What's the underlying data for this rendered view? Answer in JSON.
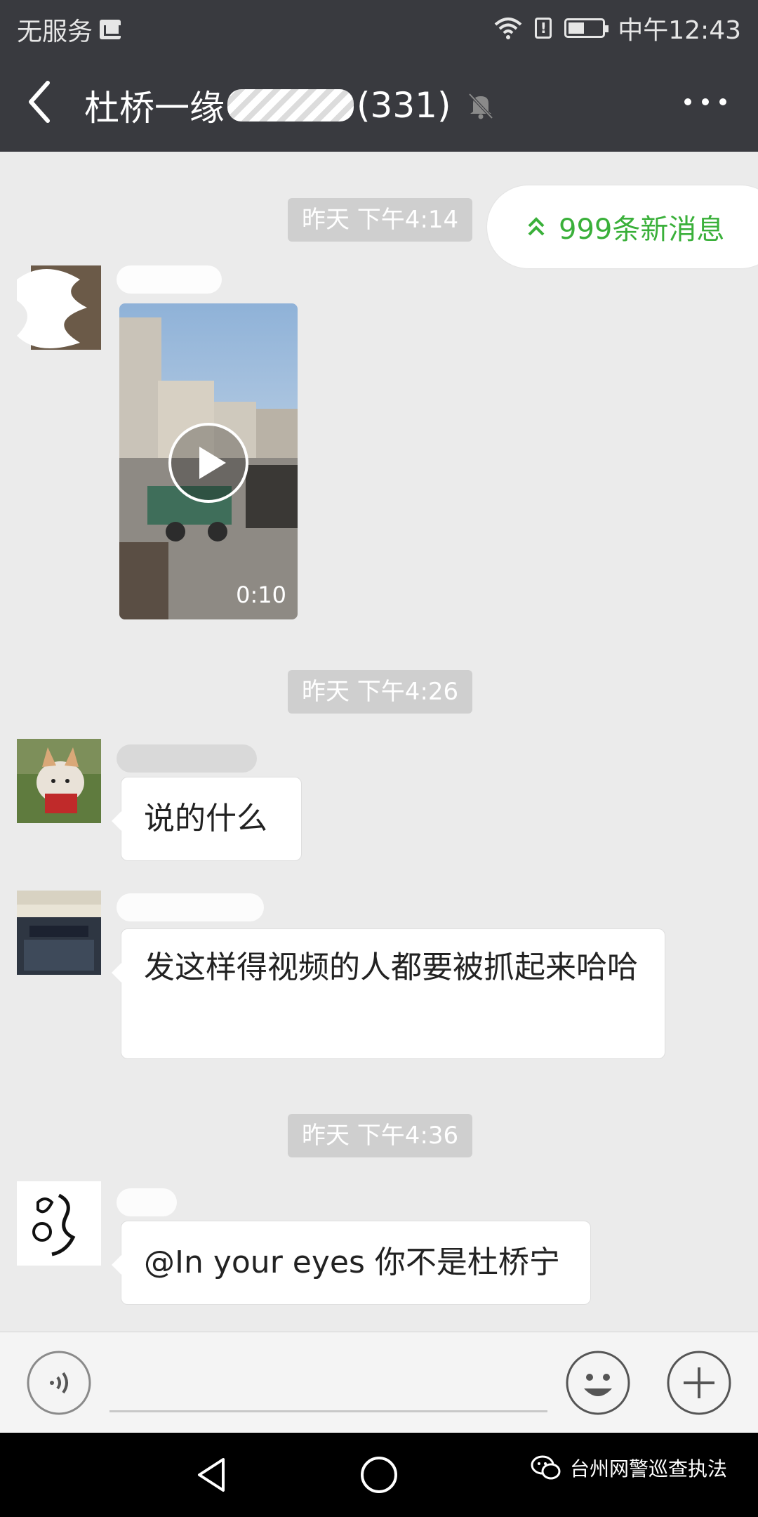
{
  "status_bar": {
    "carrier": "无服务",
    "time": "中午12:43",
    "icons": [
      "carrier-icon",
      "wifi-icon",
      "alert-icon",
      "battery-icon"
    ]
  },
  "nav": {
    "title_prefix": "杜桥一缘",
    "title_suffix": "(331)",
    "icons": [
      "back-icon",
      "mute-icon",
      "more-icon"
    ]
  },
  "new_messages": {
    "label": "999条新消息",
    "icon": "double-chevron-up-icon",
    "color": "#3ab03a"
  },
  "messages": {
    "t1": "昨天 下午4:14",
    "video_duration": "0:10",
    "t2": "昨天 下午4:26",
    "msg1": "说的什么",
    "msg2": "发这样得视频的人都要被抓起来哈哈",
    "t3": "昨天 下午4:36",
    "msg3": "@In your eyes  你不是杜桥宁"
  },
  "input_bar": {
    "placeholder": "",
    "icons": [
      "voice-icon",
      "emoji-icon",
      "plus-icon"
    ]
  },
  "system_nav": {
    "watermark": "台州网警巡查执法",
    "icons": [
      "back-triangle-icon",
      "home-circle-icon",
      "wechat-icon"
    ]
  },
  "colors": {
    "header_bg": "#393a3f",
    "chat_bg": "#ebebeb",
    "accent_green": "#3ab03a",
    "time_pill_bg": "#cfcfcf"
  }
}
